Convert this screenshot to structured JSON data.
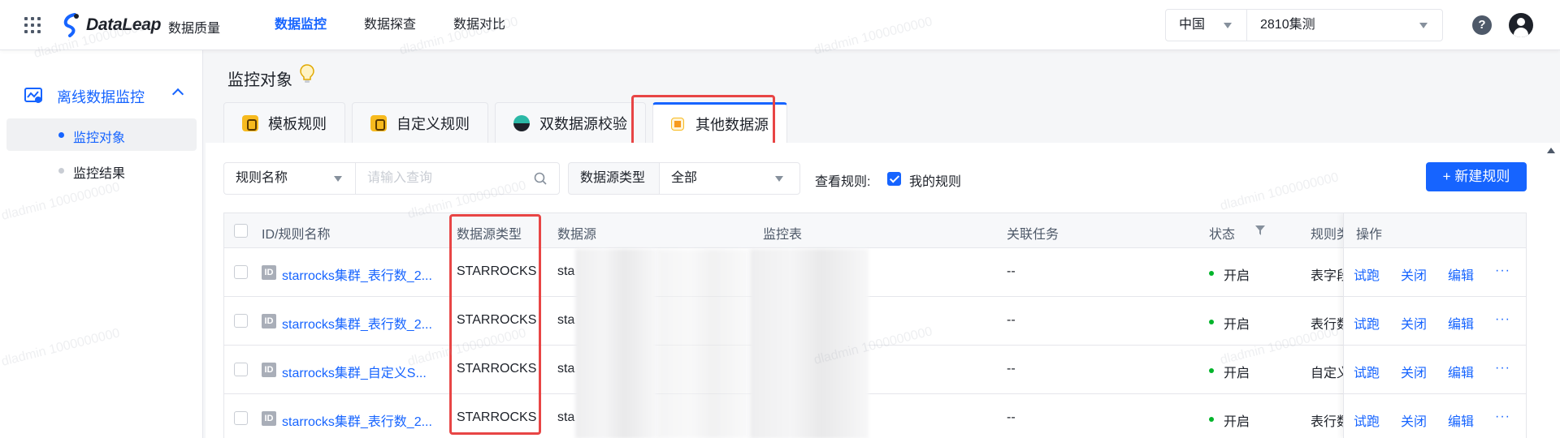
{
  "header": {
    "logo_text": "DataLeap",
    "product": "数据质量",
    "nav": [
      "数据监控",
      "数据探查",
      "数据对比"
    ],
    "region": "中国",
    "project": "2810集测"
  },
  "sidebar": {
    "group_label": "离线数据监控",
    "items": [
      {
        "label": "监控对象"
      },
      {
        "label": "监控结果"
      }
    ]
  },
  "page": {
    "title": "监控对象",
    "tabs": [
      "模板规则",
      "自定义规则",
      "双数据源校验",
      "其他数据源"
    ]
  },
  "filters": {
    "field_select": "规则名称",
    "search_placeholder": "请输入查询",
    "type_label": "数据源类型",
    "type_value": "全部",
    "view_label": "查看规则:",
    "mine_label": "我的规则",
    "new_button": "+ 新建规则"
  },
  "table": {
    "headers": [
      "ID/规则名称",
      "数据源类型",
      "数据源",
      "监控表",
      "关联任务",
      "状态",
      "规则类",
      "操作"
    ],
    "rows": [
      {
        "id_icon": "ID",
        "name": "starrocks集群_表行数_2...",
        "type": "STARROCKS",
        "source": "sta",
        "task": "--",
        "status": "开启",
        "rule_type": "表字段"
      },
      {
        "id_icon": "ID",
        "name": "starrocks集群_表行数_2...",
        "type": "STARROCKS",
        "source": "sta",
        "task": "--",
        "status": "开启",
        "rule_type": "表行数"
      },
      {
        "id_icon": "ID",
        "name": "starrocks集群_自定义S...",
        "type": "STARROCKS",
        "source": "sta",
        "task": "--",
        "status": "开启",
        "rule_type": "自定义"
      },
      {
        "id_icon": "ID",
        "name": "starrocks集群_表行数_2...",
        "type": "STARROCKS",
        "source": "sta",
        "task": "--",
        "status": "开启",
        "rule_type": "表行数"
      }
    ],
    "actions": [
      "试跑",
      "关闭",
      "编辑",
      "···"
    ]
  },
  "watermark": "dladmin 1000000000",
  "colors": {
    "primary": "#1664ff",
    "highlight": "#e84545",
    "status_on": "#00b42a"
  }
}
